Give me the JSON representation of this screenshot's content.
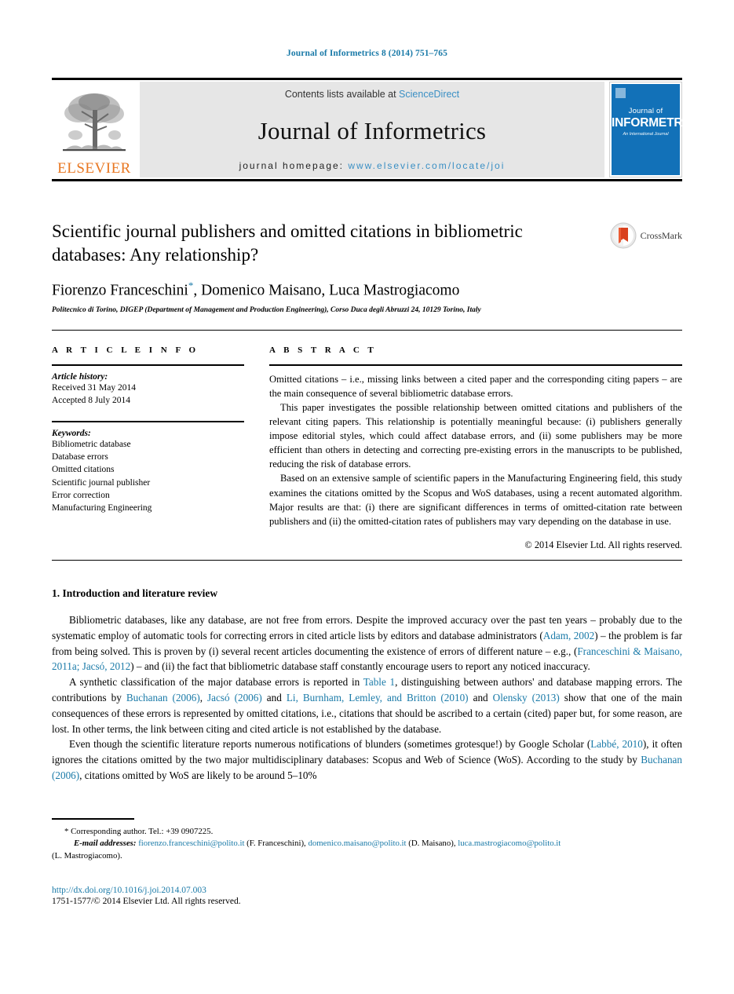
{
  "running_head": "Journal of Informetrics 8 (2014) 751–765",
  "masthead": {
    "publisher_name": "ELSEVIER",
    "contents_prefix": "Contents lists available at ",
    "contents_link": "ScienceDirect",
    "journal_title": "Journal of Informetrics",
    "homepage_label": "journal homepage:",
    "homepage_url": "www.elsevier.com/locate/joi",
    "cover": {
      "line1": "Journal of",
      "line2": "INFORMETRICS",
      "line3": "An International Journal"
    }
  },
  "article": {
    "title": "Scientific journal publishers and omitted citations in bibliometric databases: Any relationship?",
    "authors": "Fiorenzo Franceschini",
    "authors_rest": ", Domenico Maisano, Luca Mastrogiacomo",
    "corresponding_marker": "*",
    "affiliation": "Politecnico di Torino, DIGEP (Department of Management and Production Engineering), Corso Duca degli Abruzzi 24, 10129 Torino, Italy",
    "crossmark_label": "CrossMark"
  },
  "info": {
    "heading": "A R T I C L E   I N F O",
    "history_label": "Article history:",
    "history": [
      "Received 31 May 2014",
      "Accepted 8 July 2014"
    ],
    "keywords_label": "Keywords:",
    "keywords": [
      "Bibliometric database",
      "Database errors",
      "Omitted citations",
      "Scientific journal publisher",
      "Error correction",
      "Manufacturing Engineering"
    ]
  },
  "abstract": {
    "heading": "A B S T R A C T",
    "paragraphs": [
      "Omitted citations – i.e., missing links between a cited paper and the corresponding citing papers – are the main consequence of several bibliometric database errors.",
      "This paper investigates the possible relationship between omitted citations and publishers of the relevant citing papers. This relationship is potentially meaningful because: (i) publishers generally impose editorial styles, which could affect database errors, and (ii) some publishers may be more efficient than others in detecting and correcting pre-existing errors in the manuscripts to be published, reducing the risk of database errors.",
      "Based on an extensive sample of scientific papers in the Manufacturing Engineering field, this study examines the citations omitted by the Scopus and WoS databases, using a recent automated algorithm. Major results are that: (i) there are significant differences in terms of omitted-citation rate between publishers and (ii) the omitted-citation rates of publishers may vary depending on the database in use."
    ],
    "rights": "© 2014 Elsevier Ltd. All rights reserved."
  },
  "body": {
    "section_heading": "1. Introduction and literature review",
    "p1_a": "Bibliometric databases, like any database, are not free from errors. Despite the improved accuracy over the past ten years – probably due to the systematic employ of automatic tools for correcting errors in cited article lists by editors and database administrators (",
    "p1_link1": "Adam, 2002",
    "p1_b": ") – the problem is far from being solved. This is proven by (i) several recent articles documenting the existence of errors of different nature – e.g., (",
    "p1_link2": "Franceschini & Maisano, 2011a; Jacsó, 2012",
    "p1_c": ") – and (ii) the fact that bibliometric database staff constantly encourage users to report any noticed inaccuracy.",
    "p2_a": "A synthetic classification of the major database errors is reported in ",
    "p2_link1": "Table 1",
    "p2_b": ", distinguishing between authors' and database mapping errors. The contributions by ",
    "p2_link2": "Buchanan (2006)",
    "p2_c": ", ",
    "p2_link3": "Jacsó (2006)",
    "p2_d": " and ",
    "p2_link4": "Li, Burnham, Lemley, and Britton (2010)",
    "p2_e": " and ",
    "p2_link5": "Olensky (2013)",
    "p2_f": " show that one of the main consequences of these errors is represented by omitted citations, i.e., citations that should be ascribed to a certain (cited) paper but, for some reason, are lost. In other terms, the link between citing and cited article is not established by the database.",
    "p3_a": "Even though the scientific literature reports numerous notifications of blunders (sometimes grotesque!) by Google Scholar (",
    "p3_link1": "Labbé, 2010",
    "p3_b": "), it often ignores the citations omitted by the two major multidisciplinary databases: Scopus and Web of Science (WoS). According to the study by ",
    "p3_link2": "Buchanan (2006)",
    "p3_c": ", citations omitted by WoS are likely to be around 5–10%"
  },
  "footnotes": {
    "corresponding": "* Corresponding author. Tel.: +39 0907225.",
    "email_label": "E-mail addresses:",
    "email1": "fiorenzo.franceschini@polito.it",
    "email1_owner": " (F. Franceschini), ",
    "email2": "domenico.maisano@polito.it",
    "email2_owner": " (D. Maisano), ",
    "email3": "luca.mastrogiacomo@polito.it",
    "email3_owner": "(L. Mastrogiacomo).",
    "doi": "http://dx.doi.org/10.1016/j.joi.2014.07.003",
    "issn": "1751-1577/© 2014 Elsevier Ltd. All rights reserved."
  },
  "colors": {
    "link": "#1a7aa8",
    "elsevier_orange": "#E87722",
    "cover_blue": "#1271b8"
  }
}
